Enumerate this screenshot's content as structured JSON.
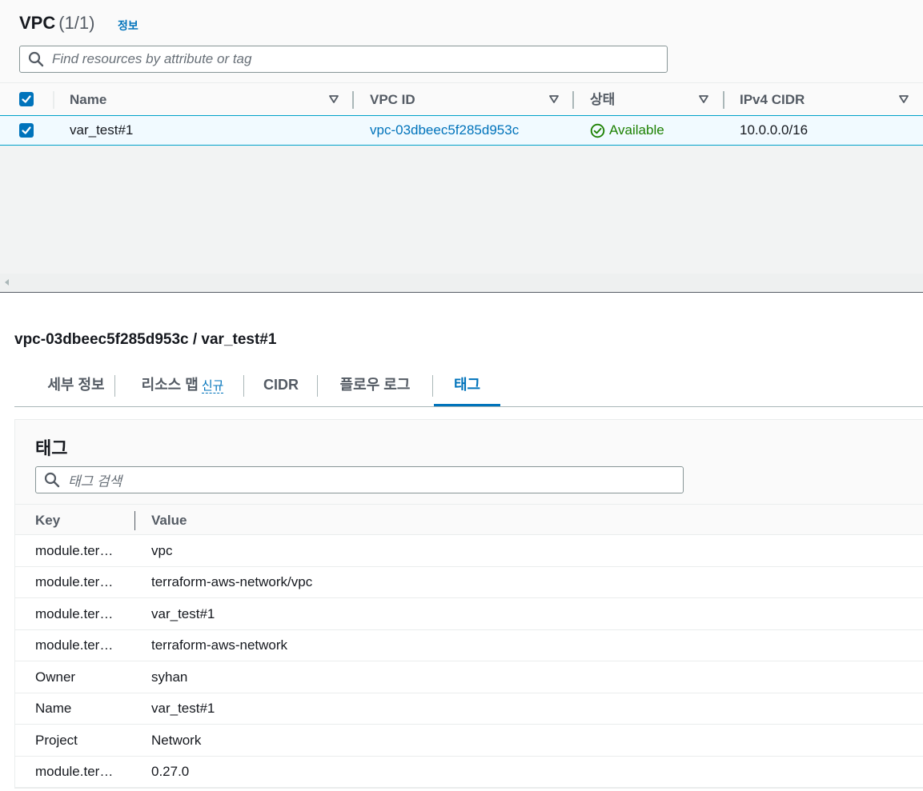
{
  "vpc_panel": {
    "title": "VPC",
    "count": "(1/1)",
    "info_link": "정보",
    "search_placeholder": "Find resources by attribute or tag",
    "columns": [
      "Name",
      "VPC ID",
      "상태",
      "IPv4 CIDR"
    ],
    "rows": [
      {
        "name": "var_test#1",
        "vpc_id": "vpc-03dbeec5f285d953c",
        "status": "Available",
        "ipv4_cidr": "10.0.0.0/16",
        "selected": true
      }
    ]
  },
  "detail": {
    "title": "vpc-03dbeec5f285d953c / var_test#1",
    "tabs": [
      {
        "label": "세부 정보"
      },
      {
        "label": "리소스 맵",
        "badge": "신규"
      },
      {
        "label": "CIDR"
      },
      {
        "label": "플로우 로그"
      },
      {
        "label": "태그",
        "active": true
      }
    ]
  },
  "tags_section": {
    "heading": "태그",
    "search_placeholder": "태그 검색",
    "columns": [
      "Key",
      "Value"
    ],
    "rows": [
      {
        "key": "module.ter…",
        "value": "vpc"
      },
      {
        "key": "module.ter…",
        "value": "terraform-aws-network/vpc"
      },
      {
        "key": "module.ter…",
        "value": "var_test#1"
      },
      {
        "key": "module.ter…",
        "value": "terraform-aws-network"
      },
      {
        "key": "Owner",
        "value": "syhan"
      },
      {
        "key": "Name",
        "value": "var_test#1"
      },
      {
        "key": "Project",
        "value": "Network"
      },
      {
        "key": "module.ter…",
        "value": "0.27.0"
      }
    ]
  },
  "colors": {
    "link": "#0073bb",
    "status_available": "#1d8102",
    "selected_row_bg": "#f1faff",
    "selected_row_border": "#00a1c9"
  }
}
